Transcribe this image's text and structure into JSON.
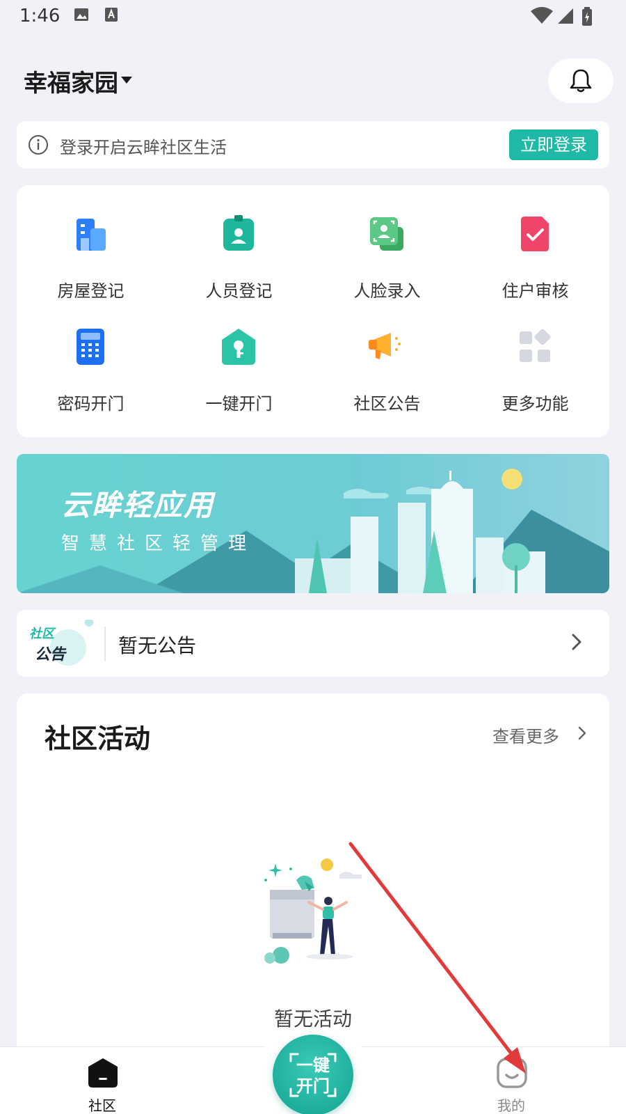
{
  "status_bar": {
    "time": "1:46"
  },
  "header": {
    "community_name": "幸福家园"
  },
  "login_banner": {
    "message": "登录开启云眸社区生活",
    "button_label": "立即登录"
  },
  "functions": [
    {
      "label": "房屋登记",
      "icon": "building-icon"
    },
    {
      "label": "人员登记",
      "icon": "person-badge-icon"
    },
    {
      "label": "人脸录入",
      "icon": "face-scan-icon"
    },
    {
      "label": "住户审核",
      "icon": "check-document-icon"
    },
    {
      "label": "密码开门",
      "icon": "keypad-icon"
    },
    {
      "label": "一键开门",
      "icon": "key-icon"
    },
    {
      "label": "社区公告",
      "icon": "megaphone-icon"
    },
    {
      "label": "更多功能",
      "icon": "more-grid-icon"
    }
  ],
  "promo_banner": {
    "title": "云眸轻应用",
    "subtitle": "智慧社区轻管理"
  },
  "notice": {
    "badge_line1": "社区",
    "badge_line2": "公告",
    "text": "暂无公告"
  },
  "activities": {
    "title": "社区活动",
    "more_label": "查看更多",
    "empty_text": "暂无活动"
  },
  "tabbar": {
    "community_label": "社区",
    "fab_line1": "一键",
    "fab_line2": "开门",
    "mine_label": "我的"
  },
  "colors": {
    "accent": "#1fb9a8",
    "background": "#f1f2f7",
    "annotation_arrow": "#e03a3a"
  }
}
